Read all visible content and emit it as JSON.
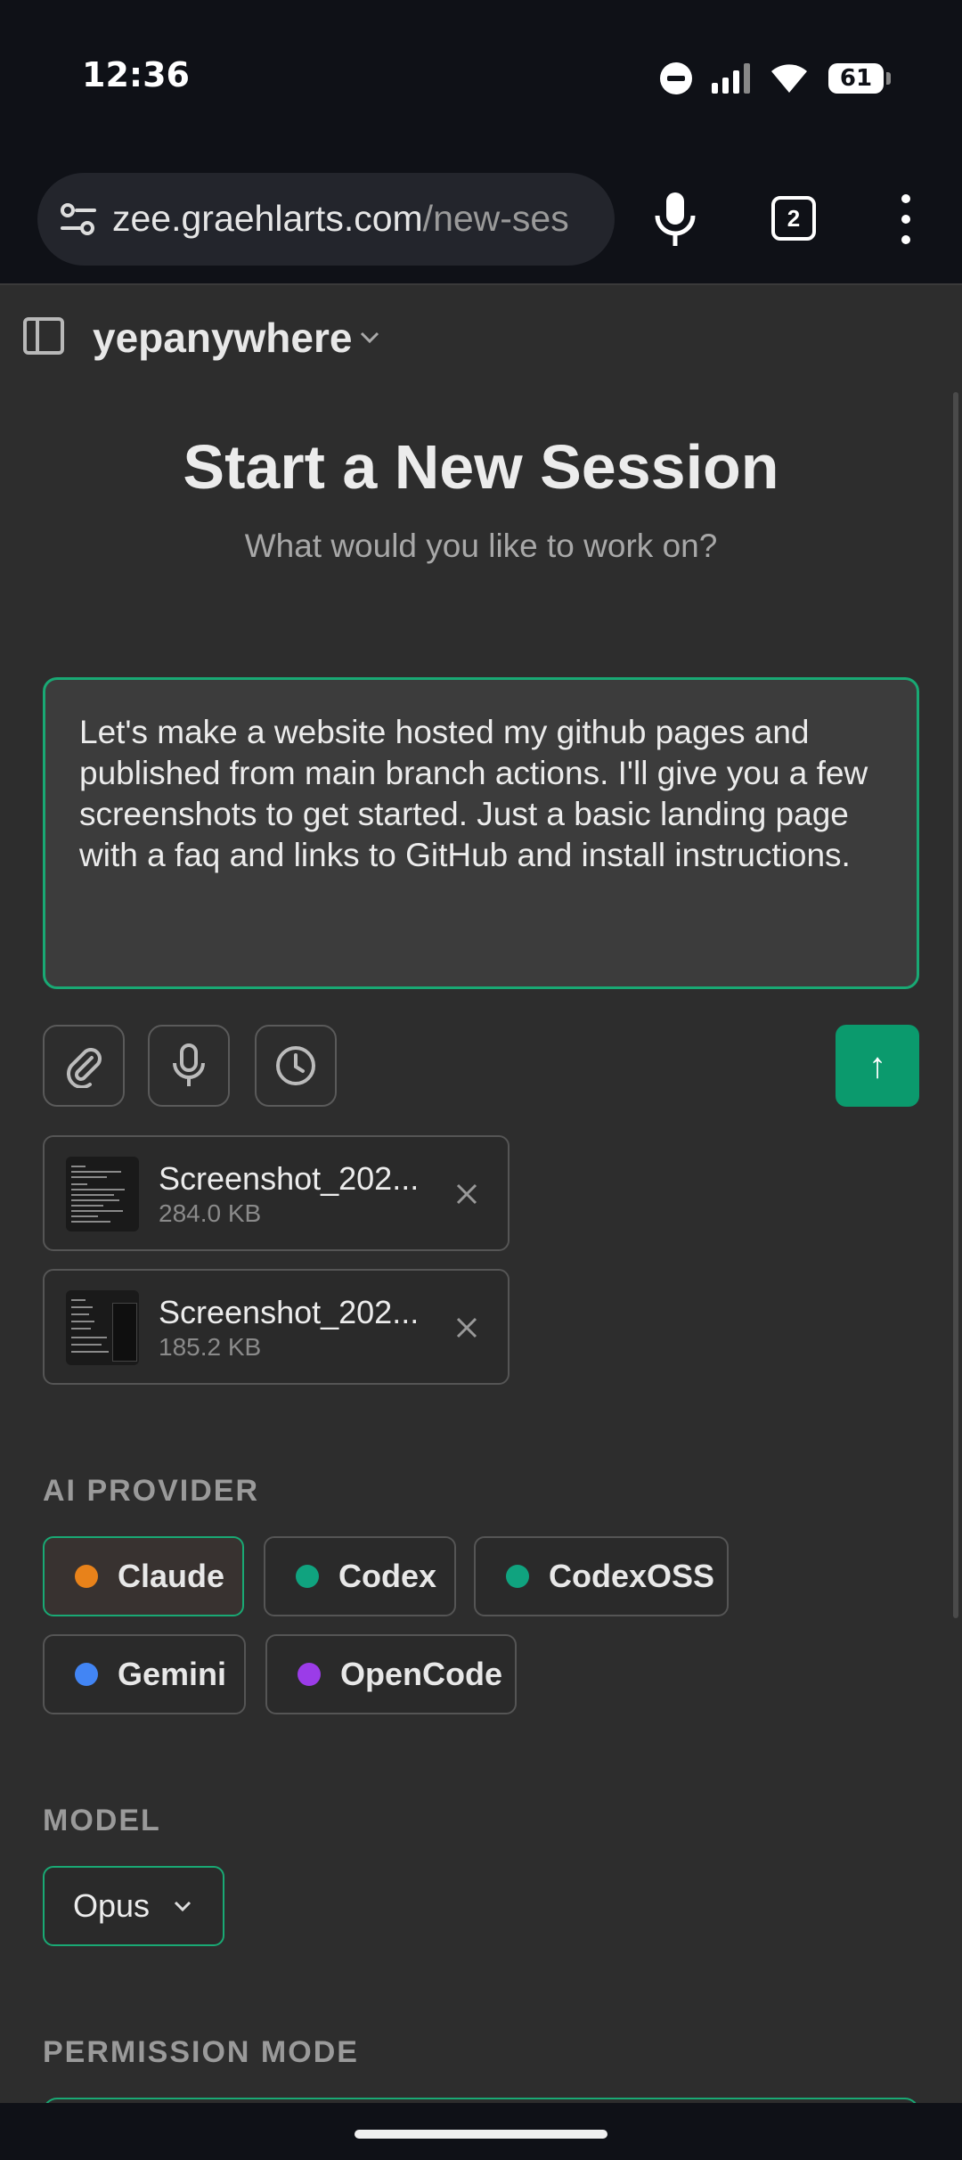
{
  "status_bar": {
    "time": "12:36",
    "battery": "61",
    "icons": [
      "do-not-disturb-icon",
      "signal-icon",
      "wifi-icon",
      "battery-icon"
    ]
  },
  "browser": {
    "url_domain": "zee.graehlarts.com",
    "url_path": "/new-ses",
    "tab_count": "2",
    "icons": [
      "site-settings-icon",
      "microphone-icon",
      "tabs-icon",
      "more-vert-icon"
    ]
  },
  "header": {
    "project": "yepanywhere"
  },
  "main": {
    "title": "Start a New Session",
    "subtitle": "What would you like to work on?",
    "prompt_text": "Let's make a website hosted my github pages and published from main branch actions. I'll give you a few screenshots to get started. Just a basic landing page with a faq and links to GitHub and install instructions.",
    "send_label": "↑",
    "toolbar_icons": [
      "paperclip-icon",
      "microphone-icon",
      "clock-icon"
    ]
  },
  "attachments": [
    {
      "name": "Screenshot_202...",
      "size": "284.0 KB"
    },
    {
      "name": "Screenshot_202...",
      "size": "185.2 KB"
    }
  ],
  "ai_provider": {
    "label": "AI PROVIDER",
    "selected": "Claude",
    "options": [
      {
        "name": "Claude",
        "color": "#e8821a"
      },
      {
        "name": "Codex",
        "color": "#10a37f"
      },
      {
        "name": "CodexOSS",
        "color": "#10a37f"
      },
      {
        "name": "Gemini",
        "color": "#4285f4"
      },
      {
        "name": "OpenCode",
        "color": "#9b3ce8"
      }
    ]
  },
  "model": {
    "label": "MODEL",
    "value": "Opus"
  },
  "permission_mode": {
    "label": "PERMISSION MODE"
  },
  "colors": {
    "accent": "#19a974",
    "send": "#0b9a6d",
    "background": "#2d2d2d"
  }
}
